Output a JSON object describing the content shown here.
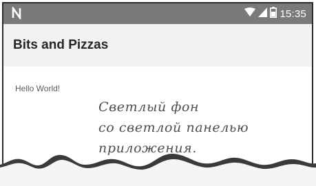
{
  "status_bar": {
    "time": "15:35",
    "icons": [
      "android-n-icon",
      "wifi-icon",
      "cell-signal-icon",
      "battery-icon"
    ]
  },
  "app_bar": {
    "title": "Bits and Pizzas"
  },
  "content": {
    "text": "Hello World!"
  },
  "annotation": {
    "lines": [
      "Светлый фон",
      "со светлой панелью",
      "приложения."
    ]
  },
  "colors": {
    "status_bar": "#7a7a7a",
    "app_bar": "#f2f2f2",
    "background": "#ffffff",
    "title_text": "#262626"
  }
}
